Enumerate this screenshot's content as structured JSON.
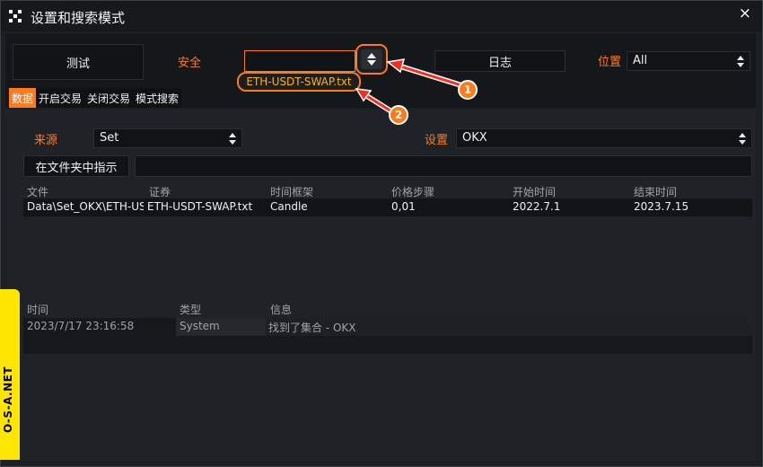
{
  "window": {
    "title": "设置和搜索模式",
    "close_glyph": "×"
  },
  "toolbar": {
    "test_label": "测试",
    "security_label": "安全",
    "security_value": "",
    "security_option": "ETH-USDT-SWAP.txt",
    "log_label": "日志",
    "position_label": "位置",
    "position_value": "All"
  },
  "tabs": [
    {
      "label": "数据",
      "active": true
    },
    {
      "label": "开启交易",
      "active": false
    },
    {
      "label": "关闭交易",
      "active": false
    },
    {
      "label": "模式搜索",
      "active": false
    }
  ],
  "source": {
    "label": "来源",
    "value": "Set"
  },
  "settings": {
    "label": "设置",
    "value": "OKX"
  },
  "folder": {
    "button_label": "在文件夹中指示",
    "path_value": ""
  },
  "data_table": {
    "columns": [
      "文件",
      "证券",
      "时间框架",
      "价格步骤",
      "开始时间",
      "结束时间"
    ],
    "rows": [
      [
        "Data\\Set_OKX\\ETH-US",
        "ETH-USDT-SWAP.txt",
        "Candle",
        "0,01",
        "2022.7.1",
        "2023.7.15"
      ]
    ]
  },
  "log_table": {
    "columns": [
      "时间",
      "类型",
      "信息"
    ],
    "rows": [
      [
        "2023/7/17 23:16:58",
        "System",
        "找到了集合 - OKX"
      ]
    ]
  },
  "watermark": "O-S-A.NET",
  "annotations": [
    {
      "label": "1"
    },
    {
      "label": "2"
    }
  ],
  "colors": {
    "accent": "#ff7a1a",
    "highlight_text": "#ffb400",
    "watermark_bg": "#ffe600"
  }
}
